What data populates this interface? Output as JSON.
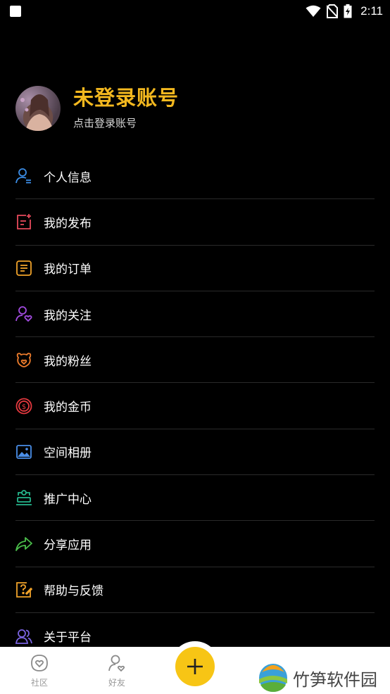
{
  "status_bar": {
    "time": "2:11"
  },
  "profile": {
    "name": "未登录账号",
    "subtitle": "点击登录账号"
  },
  "menu": [
    {
      "label": "个人信息",
      "icon": "user-info-icon",
      "color": "#3b8de6"
    },
    {
      "label": "我的发布",
      "icon": "publish-icon",
      "color": "#e74a5b"
    },
    {
      "label": "我的订单",
      "icon": "order-icon",
      "color": "#f0a22a"
    },
    {
      "label": "我的关注",
      "icon": "follow-icon",
      "color": "#a24be0"
    },
    {
      "label": "我的粉丝",
      "icon": "fans-icon",
      "color": "#ef7d2c"
    },
    {
      "label": "我的金币",
      "icon": "coin-icon",
      "color": "#e5393f"
    },
    {
      "label": "空间相册",
      "icon": "album-icon",
      "color": "#4a8ee8"
    },
    {
      "label": "推广中心",
      "icon": "promotion-icon",
      "color": "#25b58b"
    },
    {
      "label": "分享应用",
      "icon": "share-icon",
      "color": "#4bbf4b"
    },
    {
      "label": "帮助与反馈",
      "icon": "help-icon",
      "color": "#f0a22a"
    },
    {
      "label": "关于平台",
      "icon": "about-icon",
      "color": "#7a63e0"
    }
  ],
  "bottom_nav": {
    "community": "社区",
    "friends": "好友",
    "watermark": "竹笋软件园"
  },
  "colors": {
    "accent": "#f3b81f",
    "fab": "#f7c515",
    "background": "#000000"
  }
}
